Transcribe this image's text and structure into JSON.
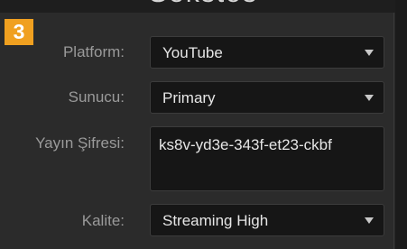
{
  "step_badge": "3",
  "header_cut_text": "Sekstos",
  "form": {
    "platform": {
      "label": "Platform:",
      "value": "YouTube"
    },
    "server": {
      "label": "Sunucu:",
      "value": "Primary"
    },
    "stream_key": {
      "label": "Yayın Şifresi:",
      "value": "ks8v-yd3e-343f-et23-ckbf"
    },
    "quality": {
      "label": "Kalite:",
      "value": "Streaming High"
    }
  },
  "icons": {
    "dropdown_caret": "chevron-down-icon"
  },
  "colors": {
    "badge": "#f0a020",
    "panel_bg": "#2b2b2b",
    "field_bg": "#161616",
    "label_text": "#9a9a9a",
    "value_text": "#e6e6e6"
  }
}
